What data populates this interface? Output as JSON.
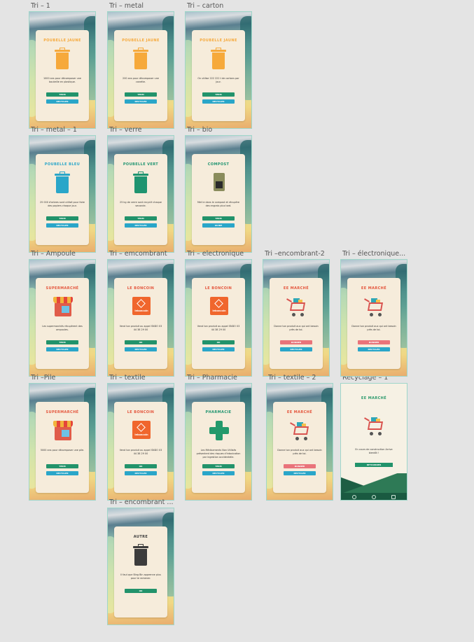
{
  "colors": {
    "yellow": "#f6a93b",
    "blue": "#2aa6c9",
    "green": "#1f9470",
    "red": "#e4553c",
    "dark": "#3c3c3c",
    "btn_green": "#22936b",
    "btn_blue": "#2aa6c9",
    "btn_red": "#e9737a"
  },
  "boards": [
    {
      "title": "Tri – 1",
      "card_title": "POUBELLE JAUNE",
      "title_color": "#f6a93b",
      "icon": "yellow-bin-icon",
      "message": "1000 ans pour décomposer une bouteille en plastique.",
      "btn1": "TERM",
      "btn1_color": "#22936b",
      "btn2": "RECYCLER",
      "btn2_color": "#2aa6c9"
    },
    {
      "title": "Tri – metal",
      "card_title": "POUBELLE JAUNE",
      "title_color": "#f6a93b",
      "icon": "yellow-bin-icon",
      "message": "200 ans pour décomposer une canette.",
      "btn1": "TERM",
      "btn1_color": "#22936b",
      "btn2": "RECYCLER",
      "btn2_color": "#2aa6c9"
    },
    {
      "title": "Tri – carton",
      "card_title": "POUBELLE JAUNE",
      "title_color": "#f6a93b",
      "icon": "yellow-bin-icon",
      "message": "On utilise 222 222 t de cartons par jour.",
      "btn1": "TERM",
      "btn1_color": "#22936b",
      "btn2": "RECYCLER",
      "btn2_color": "#2aa6c9"
    },
    {
      "title": "Tri – metal – 1",
      "card_title": "POUBELLE BLEU",
      "title_color": "#2aa6c9",
      "icon": "blue-bin-icon",
      "message": "25 000 d'arbres sont utilisé pour faire des papiers chaque jour.",
      "btn1": "TERM",
      "btn1_color": "#22936b",
      "btn2": "RECYCLER",
      "btn2_color": "#2aa6c9"
    },
    {
      "title": "Tri – verre",
      "card_title": "POUBELLE VERT",
      "title_color": "#1f9470",
      "icon": "green-bin-icon",
      "message": "25 kg de verre sont recyclé chaque seconde.",
      "btn1": "TERM",
      "btn1_color": "#22936b",
      "btn2": "RECYCLER",
      "btn2_color": "#2aa6c9"
    },
    {
      "title": "Tri – bio",
      "card_title": "COMPOST",
      "title_color": "#1f9470",
      "icon": "compost-bin-icon",
      "message": "Met le dans le compost et récupère des engrais plus tard.",
      "btn1": "TERM",
      "btn1_color": "#22936b",
      "btn2": "GUIDE",
      "btn2_color": "#2aa6c9"
    },
    {
      "title": "Tri – Ampoule",
      "card_title": "SUPERMARCHÉ",
      "title_color": "#e4553c",
      "icon": "store-icon",
      "message": "Les supermarchés récupèrent des ampoules.",
      "btn1": "TERM",
      "btn1_color": "#22936b",
      "btn2": "RECYCLER",
      "btn2_color": "#2aa6c9"
    },
    {
      "title": "Tri – emcombrant",
      "card_title": "LE BONCOIN",
      "title_color": "#e4553c",
      "icon": "leboncoin-icon",
      "message": "Vend ton produit ou appel SNDO 03 44 38 29 00",
      "btn1": "OK",
      "btn1_color": "#22936b",
      "btn2": "RECYCLER",
      "btn2_color": "#2aa6c9"
    },
    {
      "title": "Tri – electronique",
      "card_title": "LE BONCOIN",
      "title_color": "#e4553c",
      "icon": "leboncoin-icon",
      "message": "Vend ton produit ou appel SNDO 03 44 38 29 00",
      "btn1": "OK",
      "btn1_color": "#22936b",
      "btn2": "RECYCLER",
      "btn2_color": "#2aa6c9"
    },
    {
      "title": "Tri –encombrant-2",
      "card_title": "EE MARCHÉ",
      "title_color": "#e4553c",
      "icon": "cart-icon",
      "message": "Donne ton produit aux qui ont besoin près de toi.",
      "btn1": "DONNER",
      "btn1_color": "#e9737a",
      "btn2": "RECYCLER",
      "btn2_color": "#2aa6c9"
    },
    {
      "title": "Tri – électronique...",
      "card_title": "EE MARCHÉ",
      "title_color": "#e4553c",
      "icon": "cart-icon",
      "message": "Donne ton produit aux qui ont besoin près de toi.",
      "btn1": "DONNER",
      "btn1_color": "#e9737a",
      "btn2": "RECYCLER",
      "btn2_color": "#2aa6c9"
    },
    {
      "title": "Tri –Pile",
      "card_title": "SUPERMARCHÉ",
      "title_color": "#e4553c",
      "icon": "store-icon",
      "message": "5000 ans pour décomposer une pile.",
      "btn1": "TERM",
      "btn1_color": "#22936b",
      "btn2": "RECYCLER",
      "btn2_color": "#2aa6c9"
    },
    {
      "title": "Tri – textile",
      "card_title": "LE BONCOIN",
      "title_color": "#e4553c",
      "icon": "leboncoin-icon",
      "message": "Vend ton produit ou appel SNDO 03 44 38 29 00",
      "btn1": "OK",
      "btn1_color": "#22936b",
      "btn2": "RECYCLER",
      "btn2_color": "#2aa6c9"
    },
    {
      "title": "Tri – Pharmacie",
      "card_title": "PHARMACIE",
      "title_color": "#1f9470",
      "icon": "pharmacy-cross-icon",
      "message": "Les Médicaments Non Utilisés présentent des risques d'intoxication par ingestion accidentelle.",
      "btn1": "TERM",
      "btn1_color": "#22936b",
      "btn2": "RECYCLER",
      "btn2_color": "#2aa6c9"
    },
    {
      "title": "Tri – textile – 2",
      "card_title": "EE MARCHÉ",
      "title_color": "#e4553c",
      "icon": "cart-icon",
      "message": "Donne ton produit aux qui ont besoin près de toi.",
      "btn1": "DONNER",
      "btn1_color": "#e9737a",
      "btn2": "RECYCLER",
      "btn2_color": "#2aa6c9"
    },
    {
      "title": "Tri – encombrant ...",
      "card_title": "AUTRE",
      "title_color": "#3c3c3c",
      "icon": "dark-bin-icon",
      "message": "Il faut que Bing Bin apprenne plus pour te ramener.",
      "btn1": "OK",
      "btn1_color": "#22936b",
      "btn2": "",
      "btn2_color": ""
    }
  ],
  "recyclage": {
    "title": "Recyclage – 1",
    "card_title": "EE MARCHÉ",
    "icon": "cart-icon",
    "message": "En cours de construction Arrive bientôt !",
    "button": "RETOURNER"
  }
}
